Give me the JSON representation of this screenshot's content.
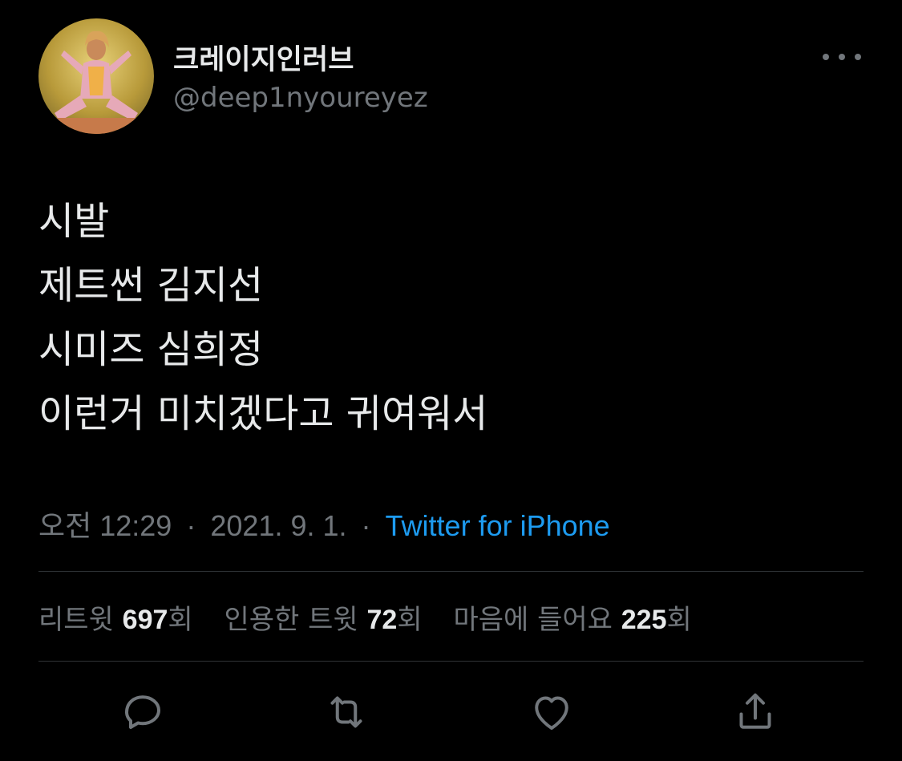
{
  "user": {
    "display_name": "크레이지인러브",
    "handle": "@deep1nyoureyez",
    "avatar_icon": "avatar-photo"
  },
  "tweet": {
    "lines": [
      "시발",
      "제트썬 김지선",
      "시미즈 심희정",
      "이런거 미치겠다고 귀여워서"
    ]
  },
  "meta": {
    "time": "오전 12:29",
    "separator": "·",
    "date": "2021. 9. 1.",
    "source": "Twitter for iPhone"
  },
  "stats": {
    "retweets": {
      "label": "리트윗",
      "count": "697",
      "suffix": "회"
    },
    "quotes": {
      "label": "인용한 트윗",
      "count": "72",
      "suffix": "회"
    },
    "likes": {
      "label": "마음에 들어요",
      "count": "225",
      "suffix": "회"
    }
  },
  "actions": {
    "reply_icon": "reply-icon",
    "retweet_icon": "retweet-icon",
    "like_icon": "heart-icon",
    "share_icon": "share-icon"
  },
  "colors": {
    "background": "#000000",
    "text_primary": "#e7e9ea",
    "text_secondary": "#71767b",
    "link": "#1d9bf0",
    "divider": "#2f3336"
  }
}
